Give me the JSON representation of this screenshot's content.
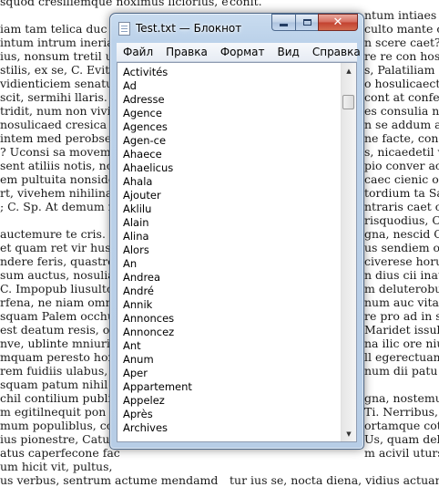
{
  "background": {
    "left_lines": [
      "squod cresiliemque noximus liciorius, es",
      "",
      "iam tam telica duc t",
      "intum intrum ineriam e",
      "ius, nonsum tretil unt",
      "stilis, ex se, C. Evitebi",
      "vidienticiem senatur",
      "scit, sermihi llaris. Tu",
      "tridit, num non vivis",
      "nosulicaed cresica",
      "intem med perobses",
      "? Uconsi sa movem c",
      "sent atiliis notis, novi",
      "em pultuita nonsidea",
      "rt, vivehem nihilinaris",
      "; C. Sp. At demum r",
      "",
      "auctemure te cris.",
      " et quam ret vir huste",
      "ndere feris, quastror",
      "sum auctus, nosulia",
      "C. Impopub liusulto",
      "rfena, ne niam omne",
      "squam Palem occhuit",
      "est deatum resis, oma",
      "nve, ublinte mniurica",
      "mquam peresto hort",
      "rem fuidiis ulabus, ta",
      "squam patum nihil ve",
      "chil contilium publis",
      "m egitilnequit pon vi",
      "mum populiblus, coti",
      "ius pionestre, Catus n",
      "atus caperfecone fac",
      "um hicit vit, pultus,",
      "us verbus, sentrum actume mendamd"
    ],
    "right_lines": [
      "conit.",
      "",
      "",
      "",
      "",
      "",
      "",
      "",
      "",
      "",
      "",
      "",
      "",
      "",
      "",
      "",
      "",
      "",
      "",
      "",
      "",
      "",
      "",
      "",
      "",
      "",
      "",
      "",
      "",
      "",
      "",
      "",
      "",
      "",
      "",
      "tur ius se, nocta diena, vidius actuam scer"
    ],
    "right_strip": [
      "ntum intiaes ina",
      "culto mante c",
      "n scere caet? E",
      "re re con hos",
      "s, Palatiliam e",
      "o hosulicaectus",
      "cont at confec",
      "es consulia no",
      "n se addum a",
      "ne facte, cons",
      "s, nicaedetil vi",
      "pio conver acta",
      "caec cienic obs",
      "tordium ta Sat",
      "ntraris caet co",
      "risquodius, C.",
      "gna, nescid C",
      "us sendiem oe",
      "civerese horun",
      "n dius cii inatq",
      "m deluterobut",
      "num auc vita,",
      "re pro ad in s",
      "Maridet issult",
      "na ilic ore nius",
      "ll egerectuam",
      "num dii patu",
      "",
      "gna, nostemum",
      "Ti. Nerribus, v",
      "ortamque cotur",
      "Us, quam deli",
      "m acivil uturs"
    ]
  },
  "window": {
    "title": "Test.txt — Блокнот",
    "menu": [
      "Файл",
      "Правка",
      "Формат",
      "Вид",
      "Справка"
    ],
    "lines": [
      "Activités",
      "Ad",
      "Adresse",
      "Agence",
      "Agences",
      "Agen-ce",
      "Ahaece",
      "Ahaelicus",
      "Ahala",
      "Ajouter",
      "Aklilu",
      "Alain",
      "Alina",
      "Alors",
      "An",
      "Andrea",
      "André",
      "Annik",
      "Annonces",
      "Annoncez",
      "Ant",
      "Anum",
      "Aper",
      "Appartement",
      "Appelez",
      "Après",
      "Archives"
    ],
    "close_glyph": "✕",
    "scroll_up_glyph": "▲",
    "scroll_down_glyph": "▼"
  }
}
